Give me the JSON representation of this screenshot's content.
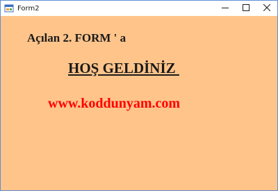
{
  "window": {
    "title": "Form2",
    "icons": {
      "app": "form-icon",
      "minimize": "minimize-icon",
      "maximize": "maximize-icon",
      "close": "close-icon"
    }
  },
  "form": {
    "label_intro": "Açılan 2. FORM ' a",
    "label_welcome": "HOŞ GELDİNİZ ",
    "label_url": "www.koddunyam.com",
    "colors": {
      "background": "#ffc48a",
      "url_text": "#ff0000",
      "text": "#1a1a1a"
    }
  }
}
